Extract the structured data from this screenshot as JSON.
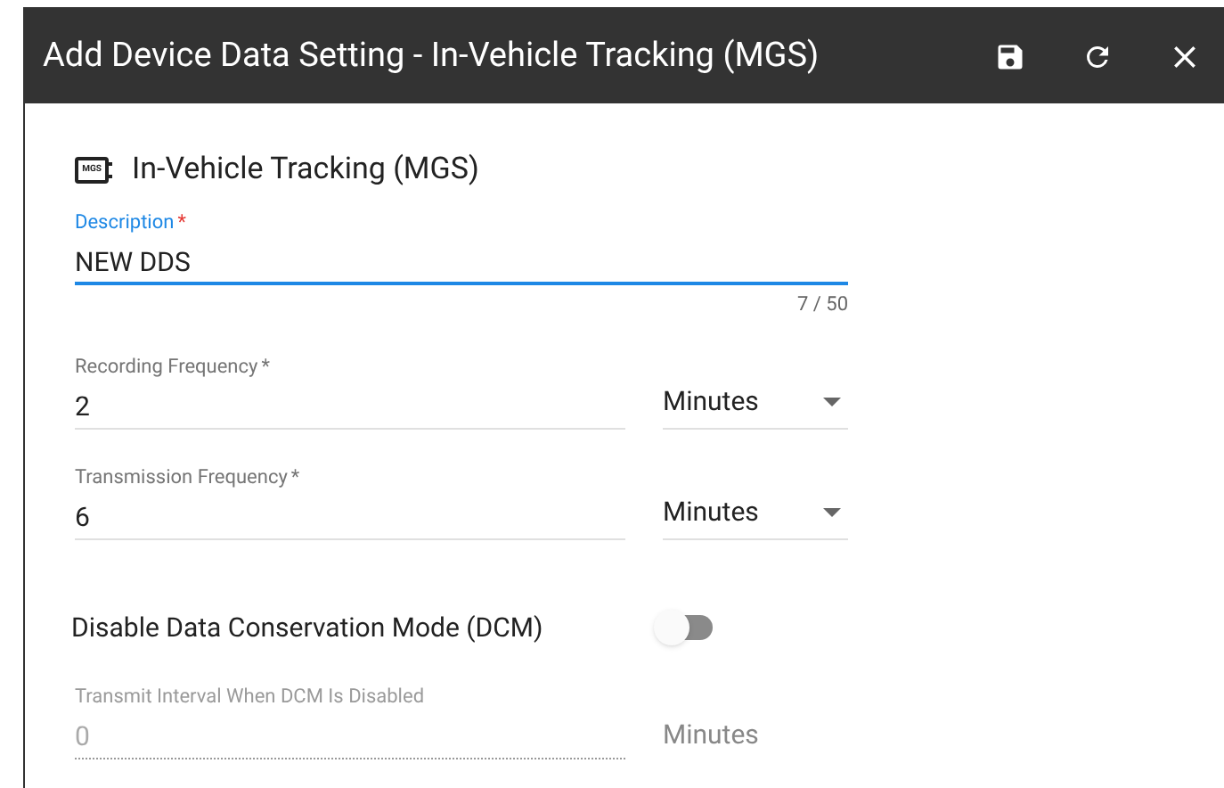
{
  "window": {
    "title": "Add Device Data Setting - In-Vehicle Tracking (MGS)",
    "actions": [
      {
        "kind": "save"
      },
      {
        "kind": "refresh"
      },
      {
        "kind": "close"
      }
    ]
  },
  "device": {
    "badge": "MGS",
    "name": "In-Vehicle Tracking (MGS)"
  },
  "description": {
    "label": "Description",
    "required_mark": "*",
    "value": "NEW DDS",
    "counter": "7 / 50",
    "focused": true
  },
  "fields": [
    {
      "kind": "number",
      "label": "Recording Frequency",
      "required_mark": "*",
      "value": "2",
      "unit": "Minutes",
      "disabled": false
    },
    {
      "kind": "number",
      "label": "Transmission Frequency",
      "required_mark": "*",
      "value": "6",
      "unit": "Minutes",
      "disabled": false
    },
    {
      "kind": "toggle",
      "label": "Disable Data Conservation Mode (DCM)",
      "on": false
    },
    {
      "kind": "number",
      "label": "Transmit Interval When DCM Is Disabled",
      "value": "0",
      "unit": "Minutes",
      "disabled": true
    }
  ]
}
